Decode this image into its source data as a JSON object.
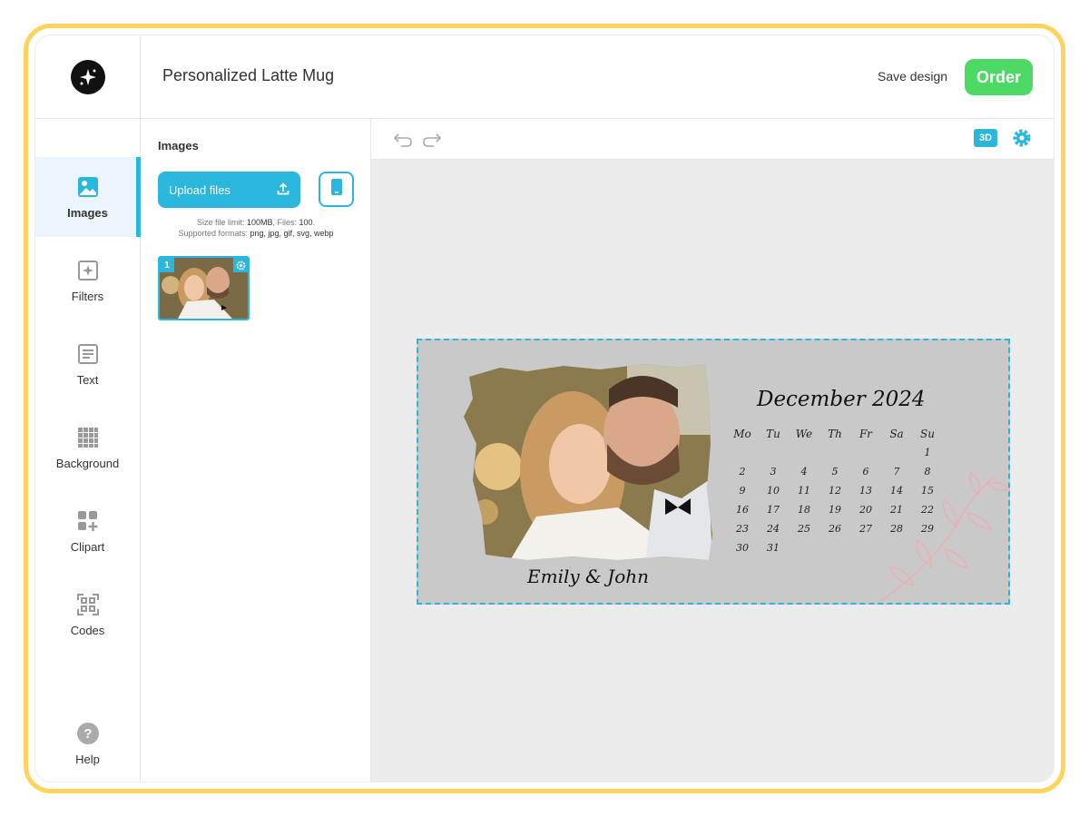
{
  "header": {
    "title": "Personalized Latte Mug",
    "save_label": "Save design",
    "order_label": "Order"
  },
  "sidebar": {
    "items": [
      {
        "label": "Images",
        "icon": "image-icon",
        "active": true
      },
      {
        "label": "Filters",
        "icon": "filters-icon"
      },
      {
        "label": "Text",
        "icon": "text-icon"
      },
      {
        "label": "Background",
        "icon": "background-icon"
      },
      {
        "label": "Clipart",
        "icon": "clipart-icon"
      },
      {
        "label": "Codes",
        "icon": "qr-code-icon"
      },
      {
        "label": "Help",
        "icon": "help-icon"
      }
    ]
  },
  "panel": {
    "title": "Images",
    "upload_label": "Upload files",
    "limit_prefix": "Size file limit: ",
    "limit_size": "100MB",
    "limit_files_prefix": ", Files: ",
    "limit_files": "100",
    "formats_prefix": "Supported formats: ",
    "formats": "png, jpg, gif, svg, webp",
    "thumbnail_number": "1"
  },
  "toolbar": {
    "mode_3d_label": "3D"
  },
  "design": {
    "names": "Emily & John",
    "calendar_title": "December 2024",
    "weekdays": [
      "Mo",
      "Tu",
      "We",
      "Th",
      "Fr",
      "Sa",
      "Su"
    ],
    "weeks": [
      [
        "",
        "",
        "",
        "",
        "",
        "",
        "1"
      ],
      [
        "2",
        "3",
        "4",
        "5",
        "6",
        "7",
        "8"
      ],
      [
        "9",
        "10",
        "11",
        "12",
        "13",
        "14",
        "15"
      ],
      [
        "16",
        "17",
        "18",
        "19",
        "20",
        "21",
        "22"
      ],
      [
        "23",
        "24",
        "25",
        "26",
        "27",
        "28",
        "29"
      ],
      [
        "30",
        "31",
        "",
        "",
        "",
        "",
        ""
      ]
    ],
    "highlighted_day": "14"
  },
  "colors": {
    "accent": "#2bb6dc",
    "order": "#4cd964",
    "frame": "#ffd35c",
    "heart": "#f4a6a8"
  }
}
